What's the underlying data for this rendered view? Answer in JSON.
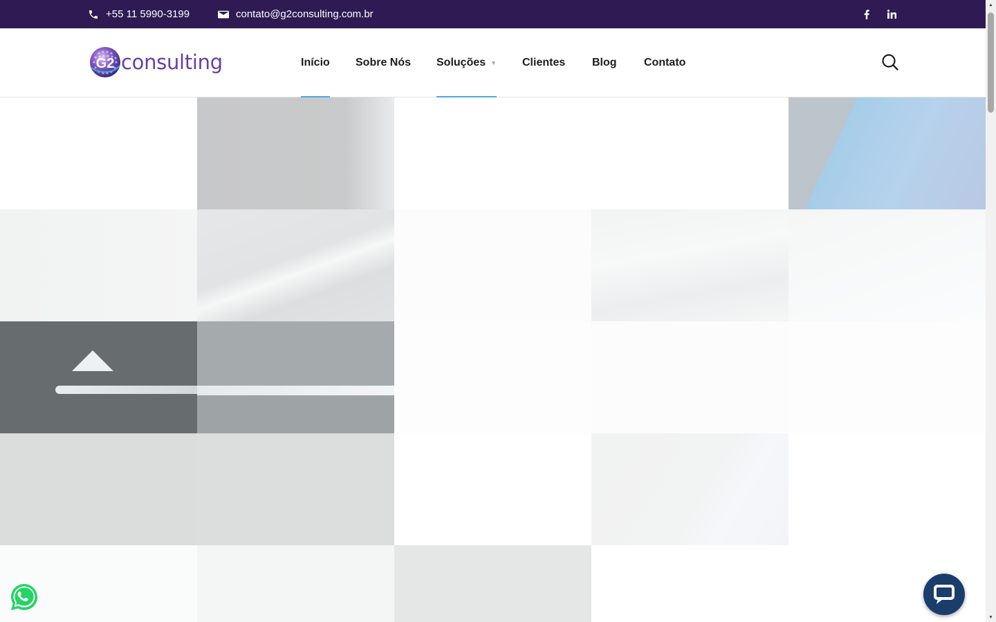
{
  "topbar": {
    "phone": "+55 11 5990-3199",
    "email": "contato@g2consulting.com.br",
    "social": [
      "facebook-icon",
      "linkedin-icon"
    ]
  },
  "header": {
    "logo_mark": "G2",
    "logo_text": "consulting",
    "nav": [
      {
        "label": "Início",
        "active": true
      },
      {
        "label": "Sobre Nós",
        "active": false
      },
      {
        "label": "Soluções",
        "active": true,
        "has_dropdown": true
      },
      {
        "label": "Clientes",
        "active": false
      },
      {
        "label": "Blog",
        "active": false
      },
      {
        "label": "Contato",
        "active": false
      }
    ],
    "search_icon": "search-icon"
  },
  "colors": {
    "topbar_bg": "#2f1a54",
    "nav_underline": "#4aa8e0",
    "logo_purple": "#6b3fa0",
    "chat_bg": "#1b3d6b",
    "whatsapp_green": "#25d366"
  },
  "widgets": {
    "whatsapp": "whatsapp-icon",
    "chat": "chat-bubble-icon"
  }
}
